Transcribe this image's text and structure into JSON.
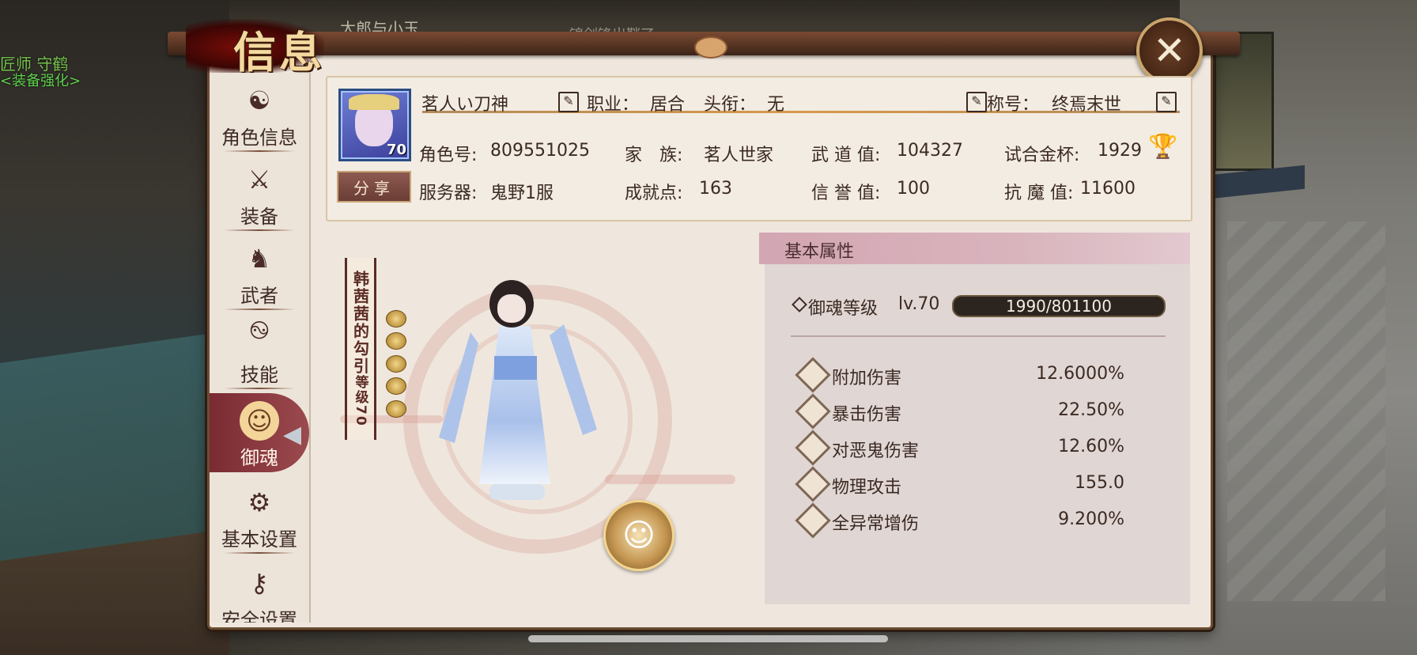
{
  "background": {
    "npc_name": "匠师 守鹤",
    "npc_action": "<装备强化>",
    "overlay_top_1": "太郎与小玉",
    "overlay_top_2": "锦剑锋出鞘了"
  },
  "window": {
    "title": "信息",
    "close_icon": "close-icon"
  },
  "sidebar": {
    "items": [
      {
        "label": "角色信息",
        "icon": "character-info-icon"
      },
      {
        "label": "装备",
        "icon": "equipment-icon"
      },
      {
        "label": "武者",
        "icon": "warrior-icon"
      },
      {
        "label": "技能",
        "icon": "skill-icon"
      },
      {
        "label": "御魂",
        "icon": "soul-icon",
        "active": true
      },
      {
        "label": "基本设置",
        "icon": "gear-icon"
      },
      {
        "label": "安全设置",
        "icon": "key-icon"
      }
    ]
  },
  "profile": {
    "avatar_level": "70",
    "name": "茗人い刀神",
    "class_label": "职业：",
    "class_value": "居合",
    "rank_label": "头衔：",
    "rank_value": "无",
    "title_label": "称号：",
    "title_value": "终焉末世",
    "share_label": "分享",
    "role_id_label": "角色号:",
    "role_id": "809551025",
    "server_label": "服务器:",
    "server": "鬼野1服",
    "family_label": "家　族:",
    "family": "茗人世家",
    "achievement_label": "成就点:",
    "achievement": "163",
    "martial_label": "武 道 值:",
    "martial": "104327",
    "honor_label": "信 誉 值:",
    "honor": "100",
    "trial_cup_label": "试合金杯:",
    "trial_cup": "1929",
    "demon_resist_label": "抗 魔 值:",
    "demon_resist": "11600"
  },
  "soul": {
    "scroll_text": "韩茜茜的勾引",
    "scroll_level_label": "等级",
    "scroll_level": "70",
    "coins": 5
  },
  "attributes": {
    "header": "基本属性",
    "soul_level_label": "御魂等级",
    "soul_level": "lv.70",
    "exp_text": "1990/801100",
    "exp_fraction": 0.0025,
    "rows": [
      {
        "name": "附加伤害",
        "value": "12.6000%",
        "icon": "extra-damage-icon"
      },
      {
        "name": "暴击伤害",
        "value": "22.50%",
        "icon": "crit-damage-icon"
      },
      {
        "name": "对恶鬼伤害",
        "value": "12.60%",
        "icon": "demon-damage-icon"
      },
      {
        "name": "物理攻击",
        "value": "155.0",
        "icon": "physical-attack-icon"
      },
      {
        "name": "全异常增伤",
        "value": "9.200%",
        "icon": "status-damage-icon"
      }
    ]
  }
}
